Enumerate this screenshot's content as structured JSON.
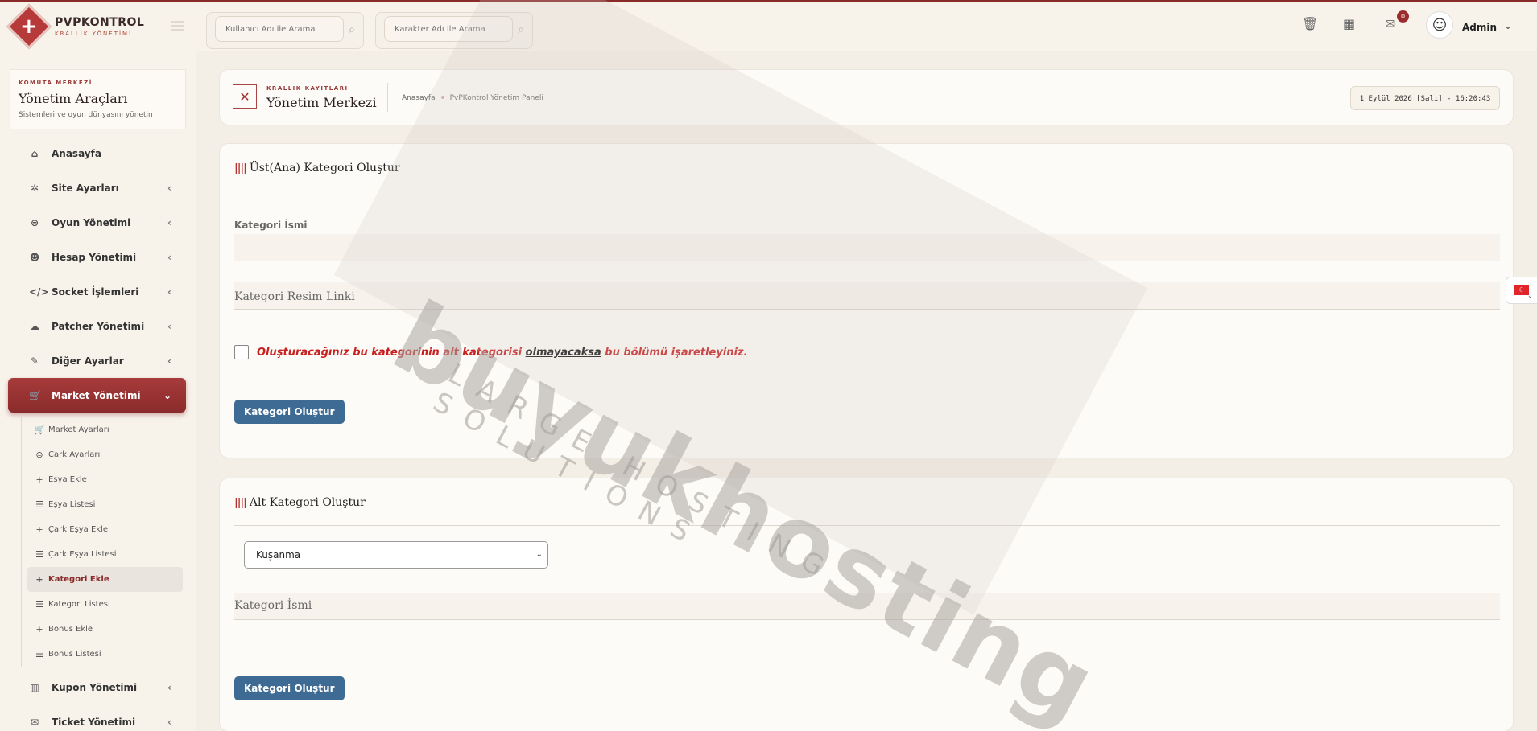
{
  "brand": {
    "title": "PVPKONTROL",
    "subtitle": "KRALLIK YÖNETİMİ"
  },
  "sidebar": {
    "header": {
      "kicker": "KOMUTA MERKEZİ",
      "title": "Yönetim Araçları",
      "desc": "Sistemleri ve oyun dünyasını yönetin"
    },
    "items": [
      {
        "label": "Anasayfa",
        "icon": "home-icon"
      },
      {
        "label": "Site Ayarları",
        "icon": "gear-icon"
      },
      {
        "label": "Oyun Yönetimi",
        "icon": "gamepad-icon"
      },
      {
        "label": "Hesap Yönetimi",
        "icon": "users-icon"
      },
      {
        "label": "Socket İşlemleri",
        "icon": "code-icon"
      },
      {
        "label": "Patcher Yönetimi",
        "icon": "cloud-icon"
      },
      {
        "label": "Diğer Ayarlar",
        "icon": "wrench-icon"
      },
      {
        "label": "Market Yönetimi",
        "icon": "cart-icon"
      }
    ],
    "sub_items": [
      {
        "label": "Market Ayarları",
        "icon": "cart-icon"
      },
      {
        "label": "Çark Ayarları",
        "icon": "gamepad-icon"
      },
      {
        "label": "Eşya Ekle",
        "icon": "plus-icon"
      },
      {
        "label": "Eşya Listesi",
        "icon": "list-icon"
      },
      {
        "label": "Çark Eşya Ekle",
        "icon": "plus-icon"
      },
      {
        "label": "Çark Eşya Listesi",
        "icon": "list-icon"
      },
      {
        "label": "Kategori Ekle",
        "icon": "plus-icon"
      },
      {
        "label": "Kategori Listesi",
        "icon": "list-icon"
      },
      {
        "label": "Bonus Ekle",
        "icon": "plus-icon"
      },
      {
        "label": "Bonus Listesi",
        "icon": "list-icon"
      }
    ],
    "items_after": [
      {
        "label": "Kupon Yönetimi",
        "icon": "barcode-icon"
      },
      {
        "label": "Ticket Yönetimi",
        "icon": "ticket-icon"
      }
    ]
  },
  "topbar": {
    "search_user_placeholder": "Kullanıcı Adı ile Arama",
    "search_char_placeholder": "Karakter Adı ile Arama",
    "notification_count": "0",
    "admin_name": "Admin"
  },
  "page_header": {
    "kicker": "KRALLIK KAYITLARI",
    "title": "Yönetim Merkezi",
    "breadcrumb": [
      "Anasayfa",
      "PvPKontrol Yönetim Paneli"
    ],
    "datetime": "1 Eylül 2026 [Salı] - 16:20:43"
  },
  "form_top": {
    "title": "Üst(Ana) Kategori Oluştur",
    "name_label": "Kategori İsmi",
    "name_value": "",
    "image_label": "Kategori Resim Linki",
    "checkbox_text_before": "Oluşturacağınız bu kategorinin alt kategorisi ",
    "checkbox_text_link": "olmayacaksa",
    "checkbox_text_after": " bu bölümü işaretleyiniz.",
    "button": "Kategori Oluştur"
  },
  "form_sub": {
    "title": "Alt Kategori Oluştur",
    "select_value": "Kuşanma",
    "name_label": "Kategori İsmi",
    "button": "Kategori Oluştur"
  },
  "watermark": {
    "text": "buyukhosting",
    "sub": "LARGE HOSTING SOLUTIONS"
  },
  "colors": {
    "accent": "#8b2a2a",
    "button": "#3e6b93",
    "warning_text": "#c81f1f"
  }
}
